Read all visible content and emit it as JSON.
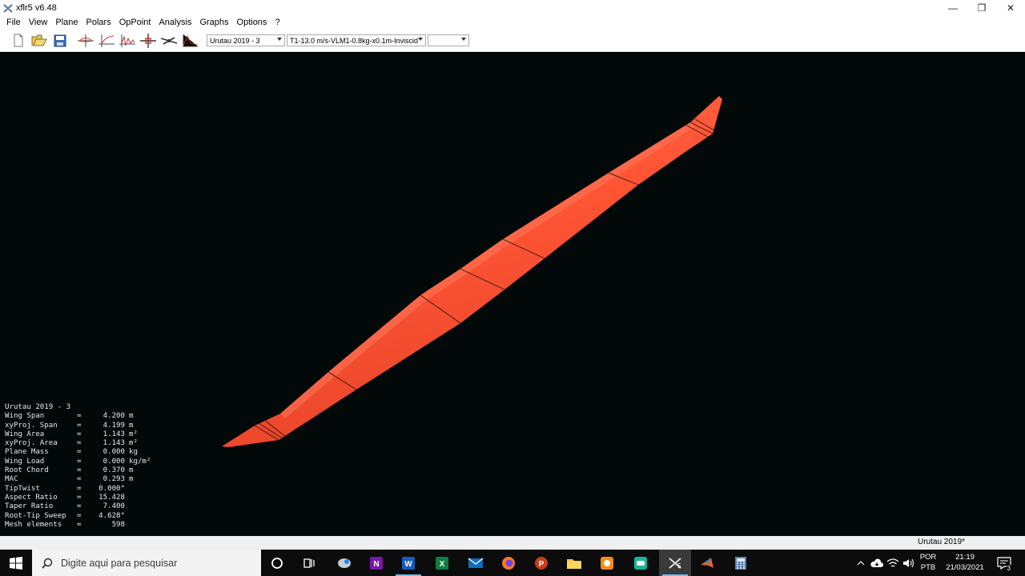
{
  "window": {
    "title": "xflr5 v6.48",
    "minimize": "—",
    "maximize": "❐",
    "close": "✕"
  },
  "menu": [
    "File",
    "View",
    "Plane",
    "Polars",
    "OpPoint",
    "Analysis",
    "Graphs",
    "Options",
    "?"
  ],
  "toolbar": {
    "plane_select": "Urutau 2019 - 3",
    "polar_select": "T1-13.0 m/s-VLM1-0.8kg-x0.1m-Inviscid",
    "opp_select": ""
  },
  "colors": {
    "wing": "#ff5a3c",
    "viewport_bg": "#020908",
    "panel_lines": "#3a1810"
  },
  "info": {
    "title": "Urutau 2019 - 3",
    "rows": [
      {
        "label": "Wing Span",
        "eq": "=",
        "value": "4.200",
        "unit": "m"
      },
      {
        "label": "xyProj. Span",
        "eq": "=",
        "value": "4.199",
        "unit": "m"
      },
      {
        "label": "Wing Area",
        "eq": "=",
        "value": "1.143",
        "unit": "m²"
      },
      {
        "label": "xyProj. Area",
        "eq": "=",
        "value": "1.143",
        "unit": "m²"
      },
      {
        "label": "Plane Mass",
        "eq": "=",
        "value": "0.000",
        "unit": "kg"
      },
      {
        "label": "Wing Load",
        "eq": "=",
        "value": "0.000",
        "unit": "kg/m²"
      },
      {
        "label": "Root Chord",
        "eq": "=",
        "value": "0.370",
        "unit": "m"
      },
      {
        "label": "MAC",
        "eq": "=",
        "value": "0.293",
        "unit": "m"
      },
      {
        "label": "TipTwist",
        "eq": "=",
        "value": "0.000°",
        "unit": ""
      },
      {
        "label": "Aspect Ratio",
        "eq": "=",
        "value": "15.428",
        "unit": ""
      },
      {
        "label": "Taper Ratio",
        "eq": "=",
        "value": "7.400",
        "unit": ""
      },
      {
        "label": "Root-Tip Sweep",
        "eq": "=",
        "value": "4.628°",
        "unit": ""
      },
      {
        "label": "Mesh elements",
        "eq": "=",
        "value": "598",
        "unit": ""
      }
    ]
  },
  "status": {
    "text": "Urutau 2019*"
  },
  "taskbar": {
    "search_placeholder": "Digite aqui para pesquisar",
    "lang_top": "POR",
    "lang_bottom": "PTB",
    "time": "21:19",
    "date": "21/03/2021",
    "notifications": "3"
  }
}
